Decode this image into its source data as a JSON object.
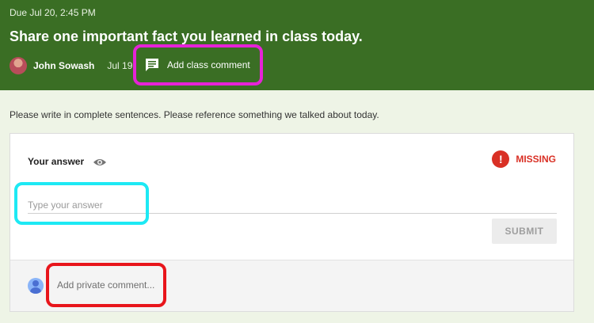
{
  "header": {
    "due": "Due Jul 20, 2:45 PM",
    "title": "Share one important fact you learned in class today.",
    "author": "John Sowash",
    "date": "Jul 19",
    "class_comment_label": "Add class comment"
  },
  "instructions": "Please write in complete sentences. Please reference something we talked about today.",
  "answer_card": {
    "label": "Your answer",
    "status": "MISSING",
    "input_placeholder": "Type your answer",
    "input_value": "",
    "submit_label": "SUBMIT"
  },
  "private_comment": {
    "placeholder": "Add private comment..."
  },
  "colors": {
    "header_bg": "#3a6e24",
    "missing_red": "#d93025",
    "highlight_magenta": "#e623d7",
    "highlight_cyan": "#1de9f4",
    "highlight_red": "#e8151b"
  },
  "icons": {
    "class_comment": "comment-icon",
    "visibility": "eye-icon",
    "status": "alert-circle-icon",
    "user": "user-avatar-icon"
  }
}
